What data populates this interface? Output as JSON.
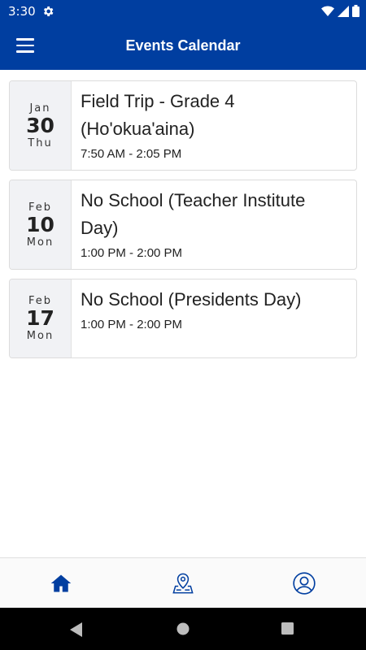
{
  "status": {
    "time": "3:30"
  },
  "app_bar": {
    "title": "Events Calendar"
  },
  "events": [
    {
      "month": "Jan",
      "day": "30",
      "dow": "Thu",
      "title": "Field Trip - Grade 4 (Ho'okua'aina)",
      "time": "7:50 AM - 2:05 PM"
    },
    {
      "month": "Feb",
      "day": "10",
      "dow": "Mon",
      "title": "No School (Teacher Institute Day)",
      "time": "1:00 PM - 2:00 PM"
    },
    {
      "month": "Feb",
      "day": "17",
      "dow": "Mon",
      "title": "No School (Presidents Day)",
      "time": "1:00 PM - 2:00 PM"
    }
  ],
  "bottom_nav": {
    "items": [
      "home-icon",
      "map-pin-icon",
      "profile-icon"
    ],
    "active": "home-icon"
  },
  "colors": {
    "primary": "#003ea0",
    "card_date_bg": "#f1f2f5"
  }
}
